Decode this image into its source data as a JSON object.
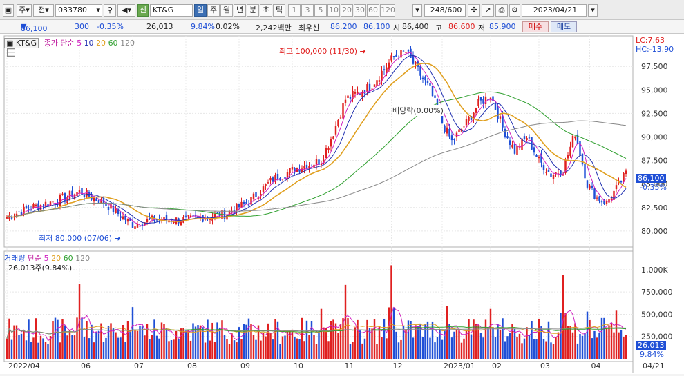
{
  "toolbar": {
    "type_label": "주",
    "market_label": "전",
    "code": "033780",
    "credit_badge": "신",
    "name": "KT&G",
    "period_tabs": [
      "일",
      "주",
      "월",
      "년",
      "분",
      "초",
      "틱"
    ],
    "interval_buttons": [
      "1",
      "3",
      "5",
      "10",
      "20",
      "30",
      "60",
      "120"
    ],
    "count": "248/600",
    "date": "2023/04/21"
  },
  "quote": {
    "price": "86,100",
    "change": "300",
    "change_pct": "-0.35%",
    "volume": "26,013",
    "volume_ratio": "9.84%",
    "turnover_pct": "0.02%",
    "amount": "2,242백만",
    "priority_label": "최우선",
    "ask": "86,200",
    "bid": "86,100",
    "open_label": "시",
    "open": "86,400",
    "high_label": "고",
    "high": "86,600",
    "low_label": "저",
    "low": "85,900",
    "buy_label": "매수",
    "sell_label": "매도"
  },
  "legend": {
    "name": "KT&G",
    "price_label": "종가 단순",
    "ma": [
      "5",
      "10",
      "20",
      "60",
      "120"
    ],
    "lc": "LC:7.63",
    "hc": "HC:-13.90",
    "vol_label": "거래량",
    "vol_ma_label": "단순",
    "vol_ma": [
      "5",
      "20",
      "60",
      "120"
    ],
    "vol_current": "26,013주(9.84%)"
  },
  "annotations": {
    "high": "최고 100,000 (11/30)",
    "low": "최저 80,000 (07/06)",
    "dividend": "배당락(0.00%)"
  },
  "price_tag": {
    "value": "86,100",
    "pct": "-0.35%"
  },
  "volume_tag": {
    "value": "26,013",
    "pct": "9.84%"
  },
  "colors": {
    "up": "#e02020",
    "down": "#1f4fd6",
    "ma5": "#d020c0",
    "ma10": "#2030b0",
    "ma20": "#e0a020",
    "ma60": "#30a030",
    "ma120": "#888888"
  },
  "chart_data": {
    "type": "candlestick",
    "y_ticks": [
      "97,500",
      "95,000",
      "92,500",
      "90,000",
      "87,500",
      "85,000",
      "82,500",
      "80,000"
    ],
    "y_tick_values": [
      97500,
      95000,
      92500,
      90000,
      87500,
      85000,
      82500,
      80000
    ],
    "ylim": [
      78600,
      100300
    ],
    "vol_ticks": [
      "1,000K",
      "750,000",
      "500,000",
      "250,000"
    ],
    "vol_tick_values": [
      1000000,
      750000,
      500000,
      250000
    ],
    "vol_ylim": [
      0,
      1100000
    ],
    "x_labels": [
      "2022/04",
      "06",
      "07",
      "08",
      "09",
      "10",
      "11",
      "12",
      "2023/01",
      "02",
      "03",
      "04",
      "04/21"
    ],
    "x_label_index": [
      0,
      30,
      52,
      74,
      96,
      118,
      139,
      159,
      180,
      200,
      220,
      241,
      255
    ],
    "anchors_idx": [
      0,
      10,
      20,
      30,
      40,
      52,
      60,
      75,
      90,
      100,
      110,
      120,
      130,
      135,
      140,
      150,
      160,
      165,
      170,
      175,
      180,
      184,
      190,
      195,
      200,
      205,
      210,
      215,
      220,
      225,
      230,
      235,
      240,
      244,
      248,
      252,
      256
    ],
    "anchors_close": [
      81500,
      82500,
      83200,
      84200,
      83000,
      80700,
      81200,
      81200,
      81800,
      83100,
      85500,
      86700,
      87500,
      90500,
      94000,
      95300,
      98500,
      99000,
      97000,
      95000,
      91500,
      89500,
      91500,
      93500,
      94500,
      91000,
      88500,
      90000,
      87500,
      86000,
      86500,
      90500,
      85000,
      83500,
      83000,
      84500,
      86100
    ],
    "volatility_pct": 0.6,
    "volume_base": 330000,
    "volume_spikes": [
      [
        30,
        840000
      ],
      [
        52,
        580000
      ],
      [
        130,
        560000
      ],
      [
        140,
        830000
      ],
      [
        159,
        1050000
      ],
      [
        182,
        590000
      ],
      [
        200,
        560000
      ],
      [
        230,
        940000
      ],
      [
        240,
        530000
      ],
      [
        252,
        540000
      ]
    ]
  }
}
